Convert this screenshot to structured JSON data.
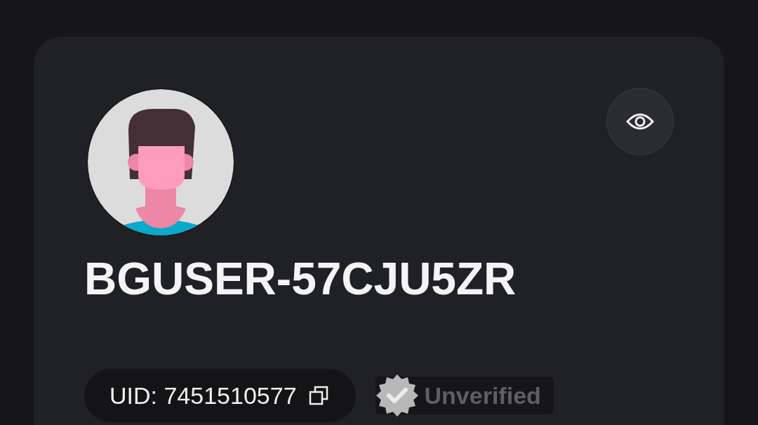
{
  "profile": {
    "username": "BGUSER-57CJU5ZR",
    "uid": "UID: 7451510577",
    "verification": {
      "label": "Unverified",
      "verified": false
    }
  }
}
